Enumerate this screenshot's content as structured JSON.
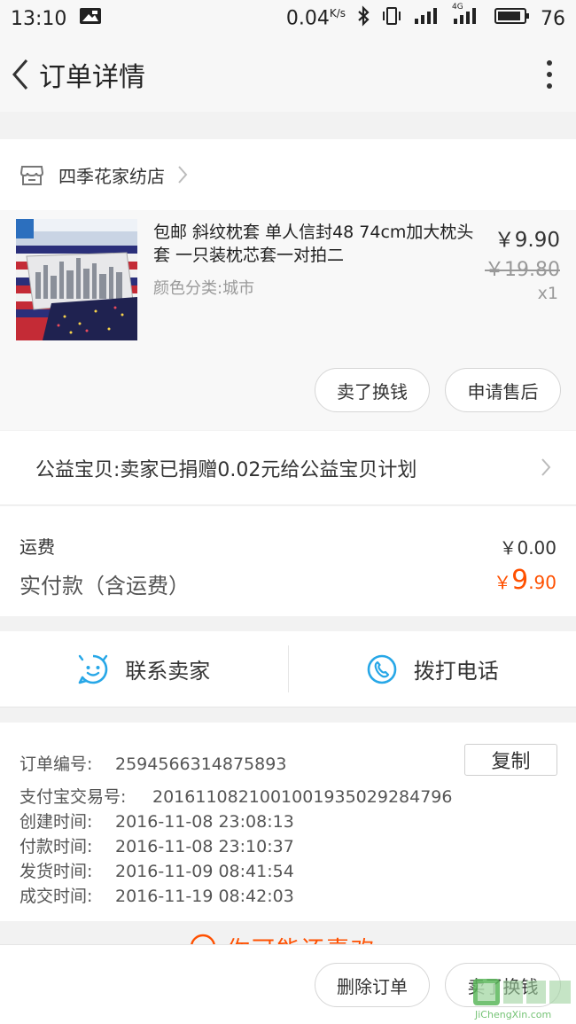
{
  "status_bar": {
    "time": "13:10",
    "speed": "0.04",
    "speed_unit": "K/s",
    "battery": "76",
    "network": "4G"
  },
  "nav": {
    "title": "订单详情"
  },
  "shop": {
    "name": "四季花家纺店"
  },
  "product": {
    "title": "包邮 斜纹枕套 单人信封48 74cm加大枕头套 一只装枕芯套一对拍二",
    "variant": "颜色分类:城市",
    "price": "￥9.90",
    "original_price": "￥19.80",
    "quantity": "x1",
    "btn_sell": "卖了换钱",
    "btn_aftersale": "申请售后"
  },
  "charity": {
    "text": "公益宝贝:卖家已捐赠0.02元给公益宝贝计划"
  },
  "fees": {
    "shipping_label": "运费",
    "shipping_value": "￥0.00",
    "paid_label": "实付款（含运费）",
    "paid_currency": "￥",
    "paid_int": "9",
    "paid_dec": ".90"
  },
  "contact": {
    "seller": "联系卖家",
    "call": "拨打电话"
  },
  "order": {
    "copy_label": "复制",
    "rows": [
      {
        "label": "订单编号:",
        "value": "2594566314875893"
      },
      {
        "label": "支付宝交易号:",
        "value": "2016110821001001935029284796"
      },
      {
        "label": "创建时间:",
        "value": "2016-11-08 23:08:13"
      },
      {
        "label": "付款时间:",
        "value": "2016-11-08 23:10:37"
      },
      {
        "label": "发货时间:",
        "value": "2016-11-09 08:41:54"
      },
      {
        "label": "成交时间:",
        "value": "2016-11-19 08:42:03"
      }
    ]
  },
  "peek": {
    "text": "你可能还喜欢"
  },
  "bottom_bar": {
    "delete": "删除订单",
    "sell": "卖了换钱"
  },
  "watermark": {
    "text": "JiChengXin.com"
  },
  "colors": {
    "accent": "#ff5000",
    "icon_blue": "#27a7e7"
  }
}
